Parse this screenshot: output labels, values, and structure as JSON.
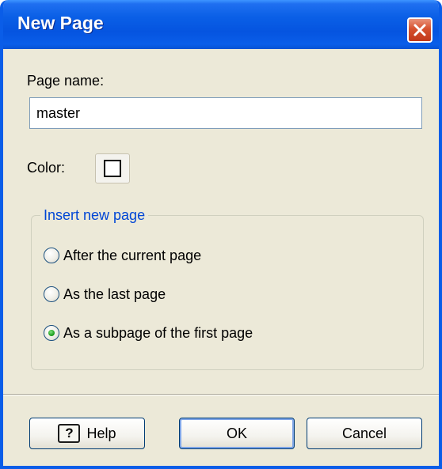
{
  "dialog": {
    "title": "New Page"
  },
  "form": {
    "page_name_label": "Page name:",
    "page_name_value": "master",
    "color_label": "Color:",
    "color_value": "#ffffff"
  },
  "insert_group": {
    "legend": "Insert new page",
    "options": [
      {
        "label": "After the current page",
        "selected": false
      },
      {
        "label": "As the last page",
        "selected": false
      },
      {
        "label": "As a subpage of the first page",
        "selected": true
      }
    ]
  },
  "buttons": {
    "help": "Help",
    "ok": "OK",
    "cancel": "Cancel"
  },
  "icons": {
    "help": "help-icon",
    "close": "close-icon"
  }
}
